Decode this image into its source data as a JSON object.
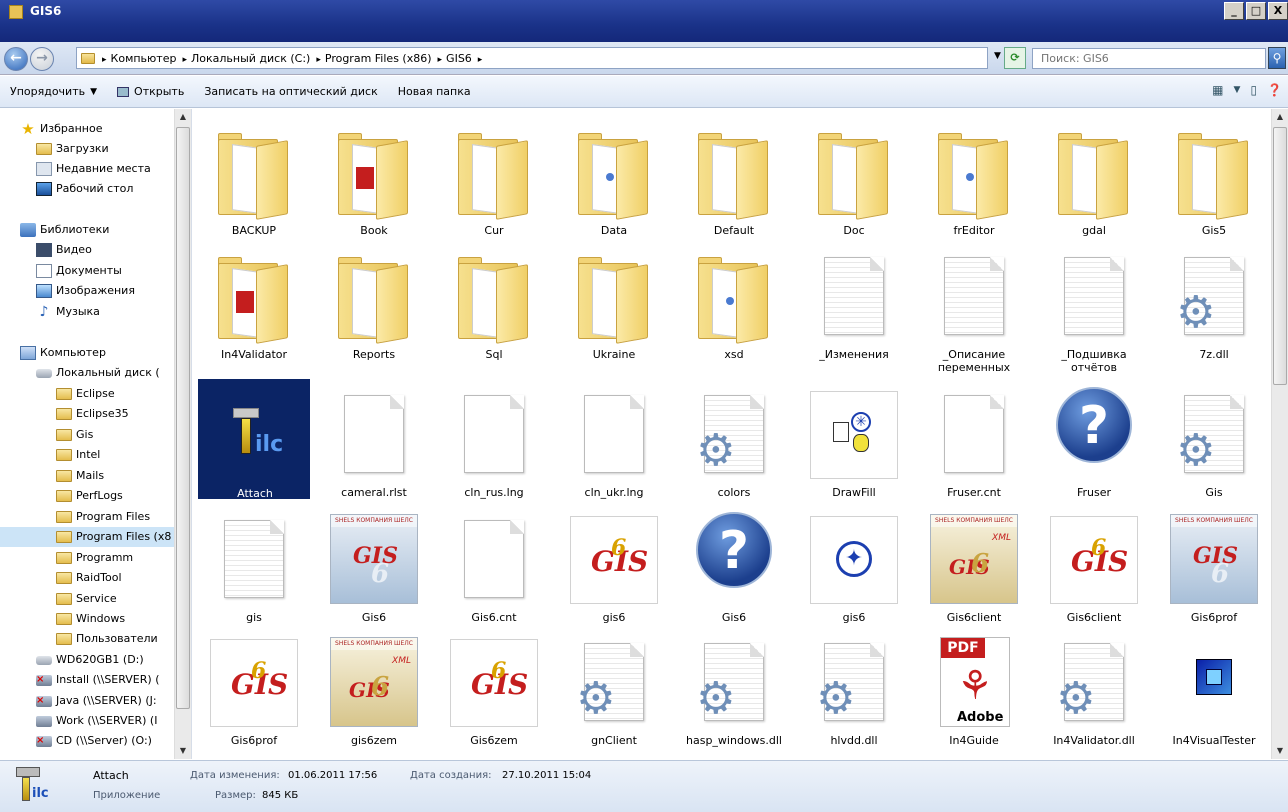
{
  "window": {
    "title": "GIS6",
    "min": "_",
    "max": "□",
    "close": "X"
  },
  "breadcrumb": [
    "Компьютер",
    "Локальный диск (C:)",
    "Program Files (x86)",
    "GIS6"
  ],
  "search": {
    "placeholder": "Поиск: GIS6"
  },
  "toolbar": {
    "organize": "Упорядочить",
    "open": "Открыть",
    "burn": "Записать на оптический диск",
    "new_folder": "Новая папка"
  },
  "nav": [
    {
      "label": "Избранное",
      "icon": "star-icon"
    },
    {
      "label": "Загрузки",
      "icon": "folder-icon"
    },
    {
      "label": "Недавние места",
      "icon": "recent-icon"
    },
    {
      "label": "Рабочий стол",
      "icon": "desktop-icon"
    },
    {
      "label": "Библиотеки",
      "icon": "library-icon"
    },
    {
      "label": "Видео",
      "icon": "video-icon"
    },
    {
      "label": "Документы",
      "icon": "documents-icon"
    },
    {
      "label": "Изображения",
      "icon": "pictures-icon"
    },
    {
      "label": "Музыка",
      "icon": "music-icon"
    },
    {
      "label": "Компьютер",
      "icon": "computer-icon"
    },
    {
      "label": "Локальный диск (",
      "icon": "drive-icon"
    },
    {
      "label": "Eclipse",
      "icon": "folder-icon"
    },
    {
      "label": "Eclipse35",
      "icon": "folder-icon"
    },
    {
      "label": "Gis",
      "icon": "folder-icon"
    },
    {
      "label": "Intel",
      "icon": "folder-icon"
    },
    {
      "label": "Mails",
      "icon": "folder-icon"
    },
    {
      "label": "PerfLogs",
      "icon": "folder-icon"
    },
    {
      "label": "Program Files",
      "icon": "folder-icon"
    },
    {
      "label": "Program Files (x8",
      "icon": "folder-icon",
      "selected": true
    },
    {
      "label": "Programm",
      "icon": "folder-icon"
    },
    {
      "label": "RaidTool",
      "icon": "folder-icon"
    },
    {
      "label": "Service",
      "icon": "folder-icon"
    },
    {
      "label": "Windows",
      "icon": "folder-icon"
    },
    {
      "label": "Пользователи",
      "icon": "folder-icon"
    },
    {
      "label": "WD620GB1 (D:)",
      "icon": "drive-icon"
    },
    {
      "label": "Install (\\\\SERVER) (",
      "icon": "network-drive-disconnected-icon"
    },
    {
      "label": "Java (\\\\SERVER) (J:",
      "icon": "network-drive-disconnected-icon"
    },
    {
      "label": "Work (\\\\SERVER) (I",
      "icon": "network-drive-icon"
    },
    {
      "label": "CD (\\\\Server) (O:)",
      "icon": "network-drive-disconnected-icon"
    }
  ],
  "items": [
    {
      "name": "BACKUP",
      "kind": "folder"
    },
    {
      "name": "Book",
      "kind": "folder-pdf"
    },
    {
      "name": "Cur",
      "kind": "folder"
    },
    {
      "name": "Data",
      "kind": "folder-dot"
    },
    {
      "name": "Default",
      "kind": "folder"
    },
    {
      "name": "Doc",
      "kind": "folder"
    },
    {
      "name": "frEditor",
      "kind": "folder-dot"
    },
    {
      "name": "gdal",
      "kind": "folder"
    },
    {
      "name": "Gis5",
      "kind": "folder"
    },
    {
      "name": "In4Validator",
      "kind": "folder-pdf"
    },
    {
      "name": "Reports",
      "kind": "folder"
    },
    {
      "name": "Sql",
      "kind": "folder"
    },
    {
      "name": "Ukraine",
      "kind": "folder"
    },
    {
      "name": "xsd",
      "kind": "folder-dot"
    },
    {
      "name": "_Изменения",
      "kind": "text"
    },
    {
      "name": "_Описание переменных",
      "kind": "text"
    },
    {
      "name": "_Подшивка отчётов",
      "kind": "text"
    },
    {
      "name": "7z.dll",
      "kind": "gearfile"
    },
    {
      "name": "Attach",
      "kind": "app",
      "selected": true
    },
    {
      "name": "cameral.rlst",
      "kind": "blank"
    },
    {
      "name": "cln_rus.lng",
      "kind": "blank"
    },
    {
      "name": "cln_ukr.lng",
      "kind": "blank"
    },
    {
      "name": "colors",
      "kind": "gearfile"
    },
    {
      "name": "DrawFill",
      "kind": "thumb-app"
    },
    {
      "name": "Fruser.cnt",
      "kind": "blank"
    },
    {
      "name": "Fruser",
      "kind": "help"
    },
    {
      "name": "Gis",
      "kind": "gearfile"
    },
    {
      "name": "gis",
      "kind": "text"
    },
    {
      "name": "Gis6",
      "kind": "cover-blue"
    },
    {
      "name": "Gis6.cnt",
      "kind": "blank"
    },
    {
      "name": "gis6",
      "kind": "gis-logo"
    },
    {
      "name": "Gis6",
      "kind": "help"
    },
    {
      "name": "gis6",
      "kind": "compass"
    },
    {
      "name": "Gis6client",
      "kind": "cover-gold"
    },
    {
      "name": "Gis6client",
      "kind": "gis-logo"
    },
    {
      "name": "Gis6prof",
      "kind": "cover-blue"
    },
    {
      "name": "Gis6prof",
      "kind": "gis-logo"
    },
    {
      "name": "gis6zem",
      "kind": "cover-gold"
    },
    {
      "name": "Gis6zem",
      "kind": "gis-logo"
    },
    {
      "name": "gnClient",
      "kind": "gearfile"
    },
    {
      "name": "hasp_windows.dll",
      "kind": "gearfile"
    },
    {
      "name": "hlvdd.dll",
      "kind": "gearfile"
    },
    {
      "name": "In4Guide",
      "kind": "pdf"
    },
    {
      "name": "In4Validator.dll",
      "kind": "gearfile"
    },
    {
      "name": "In4VisualTester",
      "kind": "cube-app"
    }
  ],
  "details": {
    "name": "Attach",
    "type": "Приложение",
    "modified_label": "Дата изменения:",
    "modified": "01.06.2011 17:56",
    "created_label": "Дата создания:",
    "created": "27.10.2011 15:04",
    "size_label": "Размер:",
    "size": "845 КБ"
  },
  "cover_text": {
    "company": "SHELS КОМПАНИЯ ШЕЛС",
    "logo": "GIS",
    "version": "6",
    "xml": "XML"
  },
  "pdf_text": {
    "tag": "PDF",
    "brand": "Adobe"
  },
  "colors": {
    "title_bar": "#1a3288",
    "selection": "#0b2465",
    "nav_selected": "#cce4f7",
    "gis_red": "#c41e1e"
  }
}
